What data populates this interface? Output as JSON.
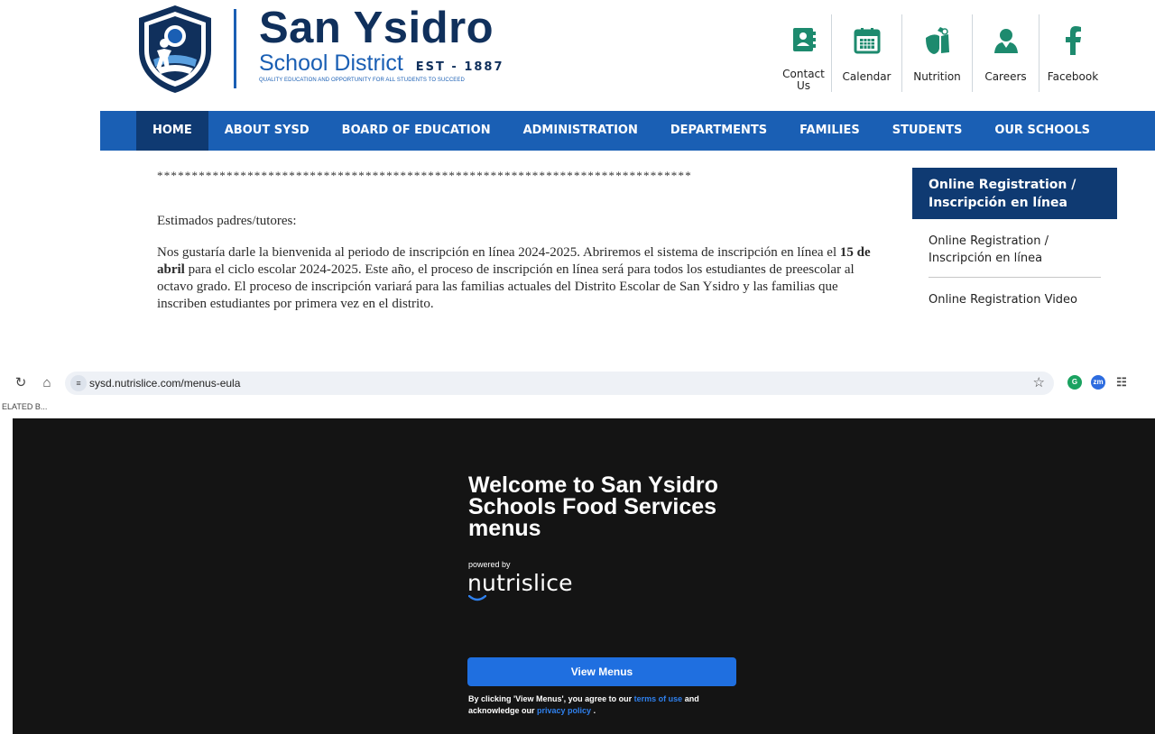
{
  "site": {
    "brand_name": "San Ysidro",
    "brand_sub": "School District",
    "brand_est": "EST - 1887",
    "tagline": "QUALITY EDUCATION AND OPPORTUNITY FOR ALL STUDENTS TO SUCCEED",
    "quick_links": [
      {
        "label": "Contact Us",
        "icon": "contact-icon"
      },
      {
        "label": "Calendar",
        "icon": "calendar-icon"
      },
      {
        "label": "Nutrition",
        "icon": "nutrition-icon"
      },
      {
        "label": "Careers",
        "icon": "careers-icon"
      },
      {
        "label": "Facebook",
        "icon": "facebook-icon"
      }
    ],
    "nav": [
      "HOME",
      "ABOUT SYSD",
      "BOARD OF EDUCATION",
      "ADMINISTRATION",
      "DEPARTMENTS",
      "FAMILIES",
      "STUDENTS",
      "OUR SCHOOLS"
    ],
    "announcement": {
      "stars": "*****************************************************************************",
      "greeting": "Estimados padres/tutores:",
      "text_before": "Nos gustaría darle la bienvenida al periodo de inscripción en línea 2024-2025. Abriremos el sistema de inscripción en línea el ",
      "text_bold": "15 de abril",
      "text_after": " para el ciclo escolar 2024-2025. Este año, el proceso de inscripción en línea será para todos los estudiantes de preescolar al octavo grado. El proceso de inscripción variará para las familias actuales del Distrito Escolar de San Ysidro y las familias que inscriben estudiantes por primera vez en el distrito."
    },
    "side_panel": {
      "header": "Online Registration / Inscripción en línea",
      "links": [
        "Online Registration / Inscripción en línea",
        "Online Registration Video"
      ]
    }
  },
  "browser": {
    "url": "sysd.nutrislice.com/menus-eula",
    "bookmark": "ELATED B..."
  },
  "nutrislice": {
    "welcome": "Welcome to San Ysidro Schools Food Services menus",
    "powered_by": "powered by",
    "logo_text": "nutrislice",
    "button": "View Menus",
    "terms_before": "By clicking 'View Menus', you agree to our ",
    "terms_link": "terms of use",
    "terms_mid": " and acknowledge our ",
    "privacy_link": "privacy policy",
    "terms_end": " ."
  },
  "colors": {
    "brand_navy": "#10305c",
    "brand_blue": "#1a5fb4",
    "nav_active": "#0f3a72",
    "icon_green": "#1d8a6e",
    "nutri_bg": "#141414",
    "button_blue": "#1f6fe0"
  }
}
